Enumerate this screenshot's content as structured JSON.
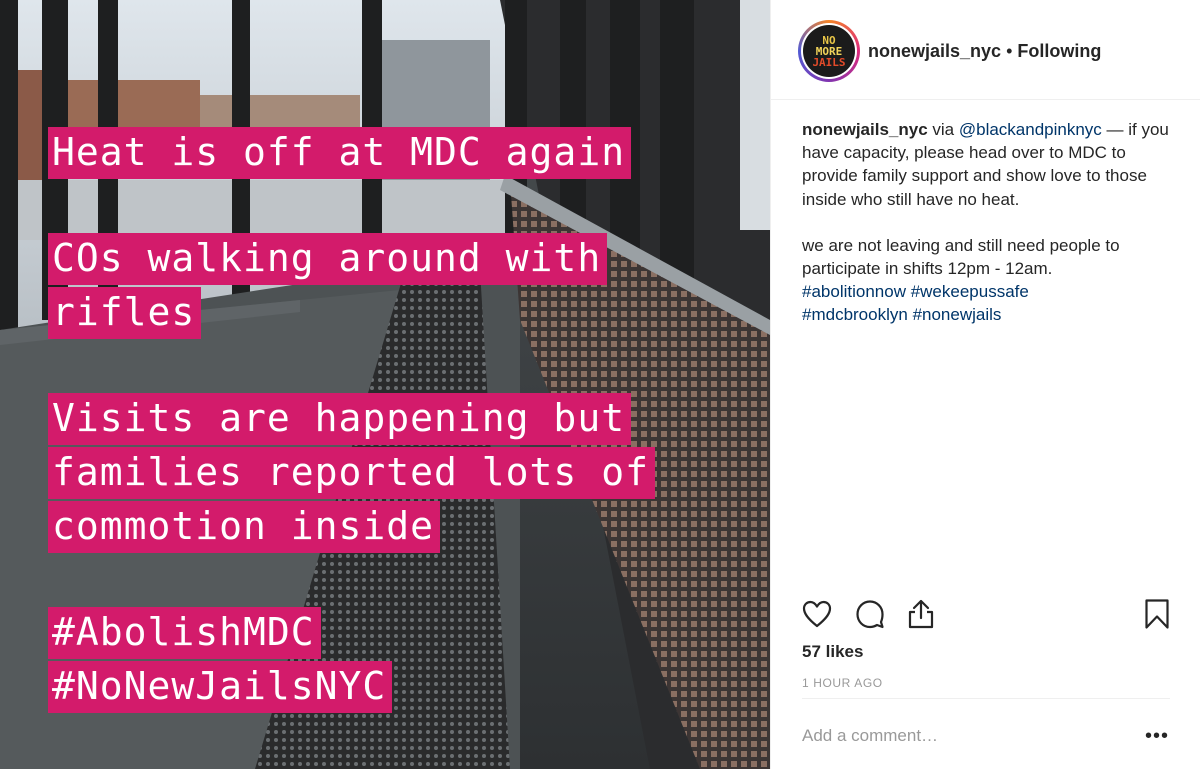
{
  "photo": {
    "caption_lines": [
      {
        "text": "Heat is off at MDC again",
        "gap_before": false
      },
      {
        "text": "COs walking around with",
        "gap_before": true
      },
      {
        "text": "rifles",
        "gap_before": false
      },
      {
        "text": "Visits are happening but",
        "gap_before": true
      },
      {
        "text": "families reported lots of",
        "gap_before": false
      },
      {
        "text": "commotion inside",
        "gap_before": false
      },
      {
        "text": "#AbolishMDC",
        "gap_before": true
      },
      {
        "text": "#NoNewJailsNYC",
        "gap_before": false
      }
    ],
    "highlight_color": "#d31b6b"
  },
  "header": {
    "avatar_lines": [
      "NO",
      "MORE",
      "JAILS"
    ],
    "username": "nonewjails_nyc",
    "separator": "•",
    "follow_status": "Following"
  },
  "post": {
    "username": "nonewjails_nyc",
    "via": " via ",
    "mention": "@blackandpinknyc",
    "text_1": " — if you have capacity, please head over to MDC to provide family support and show love to those inside who still have no heat.",
    "text_2": "we are not leaving and still need people to participate in shifts 12pm - 12am.",
    "hashtags": [
      "#abolitionnow",
      "#wekeepussafe",
      "#mdcbrooklyn",
      "#nonewjails"
    ]
  },
  "actions": {
    "like_icon": "heart-icon",
    "comment_icon": "comment-icon",
    "share_icon": "share-icon",
    "save_icon": "bookmark-icon"
  },
  "likes": "57 likes",
  "timestamp": "1 HOUR AGO",
  "comment": {
    "placeholder": "Add a comment…",
    "more_label": "•••"
  }
}
